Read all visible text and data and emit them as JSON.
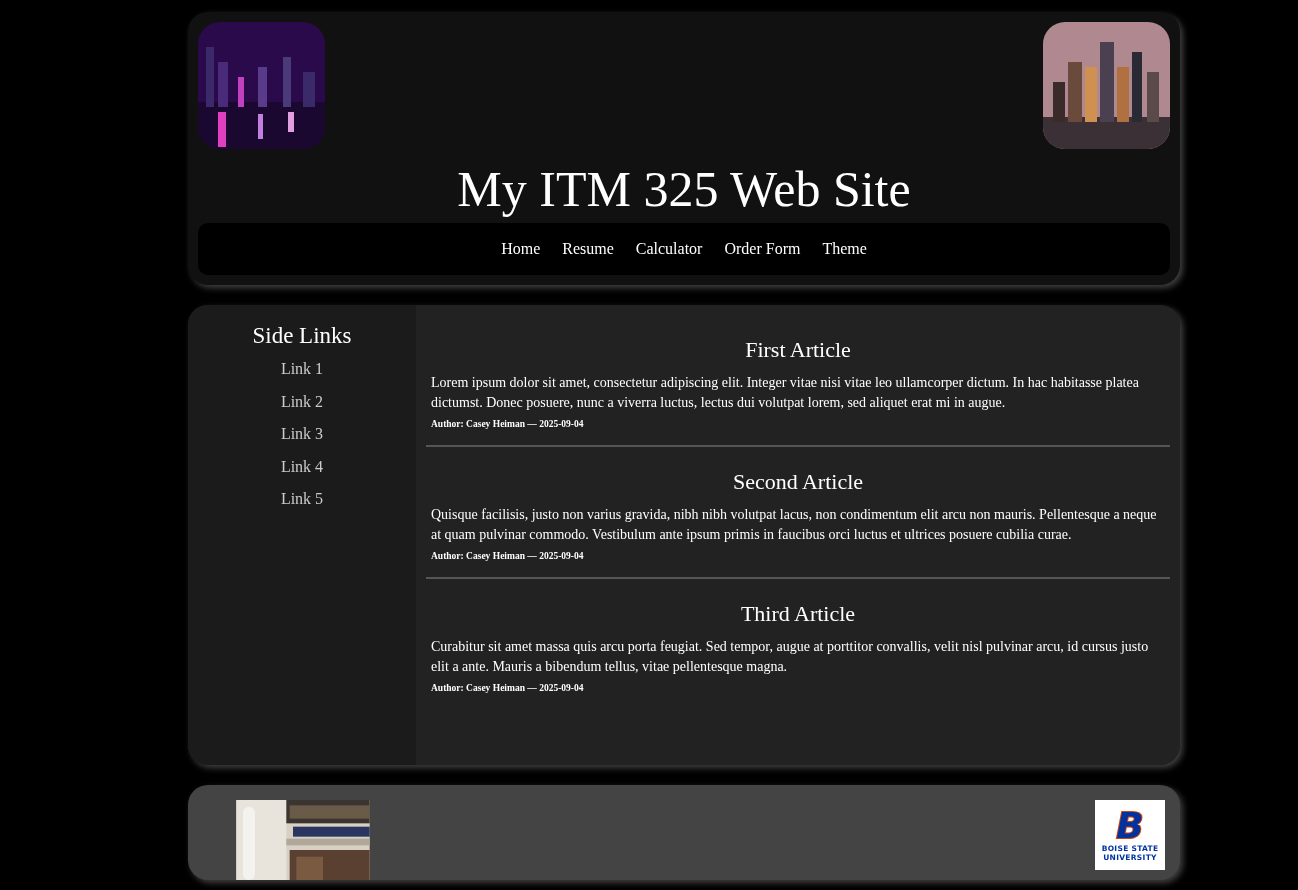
{
  "header": {
    "title": "My ITM 325 Web Site"
  },
  "nav": {
    "items": [
      {
        "label": "Home"
      },
      {
        "label": "Resume"
      },
      {
        "label": "Calculator"
      },
      {
        "label": "Order Form"
      },
      {
        "label": "Theme"
      }
    ]
  },
  "sidebar": {
    "title": "Side Links",
    "links": [
      {
        "label": "Link 1"
      },
      {
        "label": "Link 2"
      },
      {
        "label": "Link 3"
      },
      {
        "label": "Link 4"
      },
      {
        "label": "Link 5"
      }
    ]
  },
  "articles": [
    {
      "title": "First Article",
      "body": "Lorem ipsum dolor sit amet, consectetur adipiscing elit. Integer vitae nisi vitae leo ullamcorper dictum. In hac habitasse platea dictumst. Donec posuere, nunc a viverra luctus, lectus dui volutpat lorem, sed aliquet erat mi in augue.",
      "byline": "Author: Casey Heiman — 2025-09-04"
    },
    {
      "title": "Second Article",
      "body": "Quisque facilisis, justo non varius gravida, nibh nibh volutpat lacus, non condimentum elit arcu non mauris. Pellentesque a neque at quam pulvinar commodo. Vestibulum ante ipsum primis in faucibus orci luctus et ultrices posuere cubilia curae.",
      "byline": "Author: Casey Heiman — 2025-09-04"
    },
    {
      "title": "Third Article",
      "body": "Curabitur sit amet massa quis arcu porta feugiat. Sed tempor, augue at porttitor convallis, velit nisl pulvinar arcu, id cursus justo elit a ante. Mauris a bibendum tellus, vitae pellentesque magna.",
      "byline": "Author: Casey Heiman — 2025-09-04"
    }
  ],
  "footer": {
    "logo": {
      "mark": "B",
      "lines": [
        "BOISE STATE",
        "UNIVERSITY"
      ]
    }
  }
}
